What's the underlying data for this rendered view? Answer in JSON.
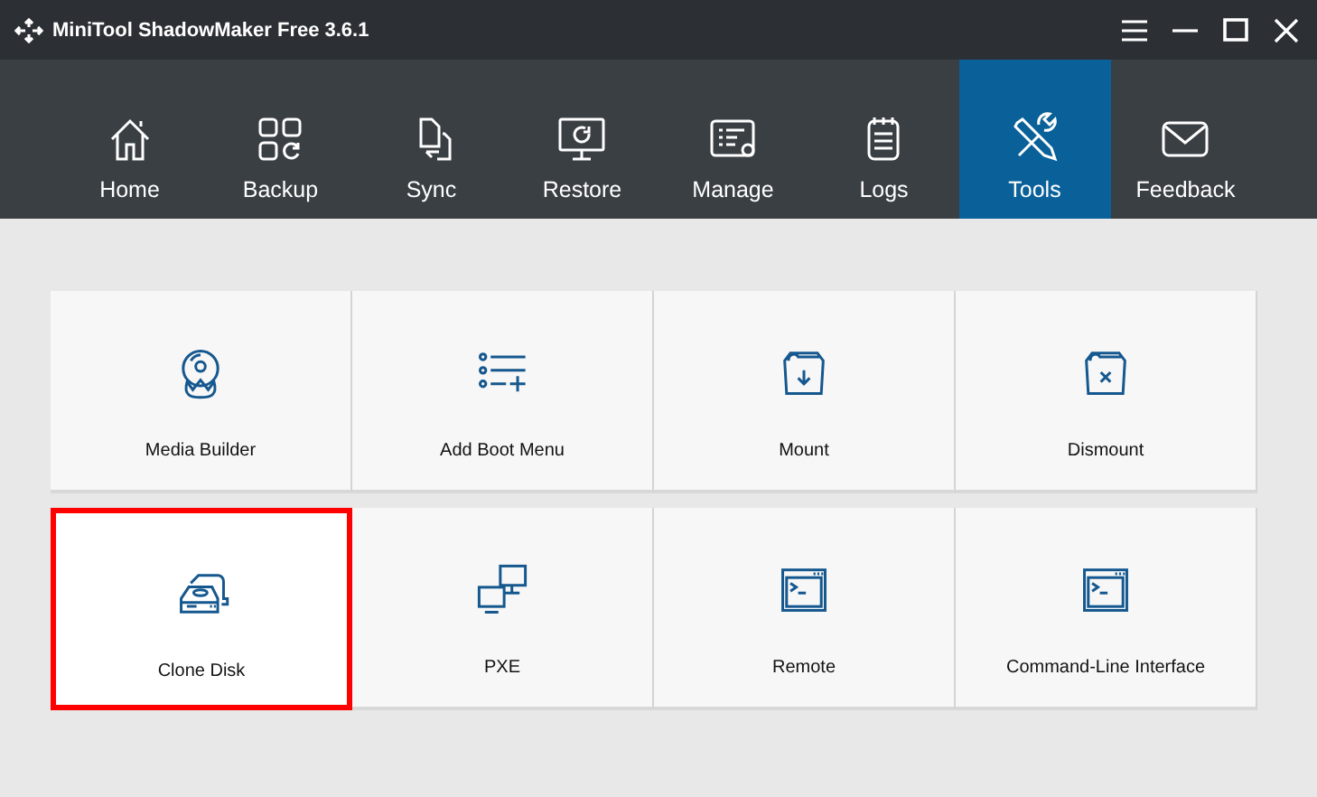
{
  "window": {
    "title": "MiniTool ShadowMaker Free 3.6.1"
  },
  "nav": [
    {
      "label": "Home",
      "selected": false
    },
    {
      "label": "Backup",
      "selected": false
    },
    {
      "label": "Sync",
      "selected": false
    },
    {
      "label": "Restore",
      "selected": false
    },
    {
      "label": "Manage",
      "selected": false
    },
    {
      "label": "Logs",
      "selected": false
    },
    {
      "label": "Tools",
      "selected": true
    },
    {
      "label": "Feedback",
      "selected": false
    }
  ],
  "tools": [
    {
      "label": "Media Builder",
      "highlighted": false
    },
    {
      "label": "Add Boot Menu",
      "highlighted": false
    },
    {
      "label": "Mount",
      "highlighted": false
    },
    {
      "label": "Dismount",
      "highlighted": false
    },
    {
      "label": "Clone Disk",
      "highlighted": true
    },
    {
      "label": "PXE",
      "highlighted": false
    },
    {
      "label": "Remote",
      "highlighted": false
    },
    {
      "label": "Command-Line Interface",
      "highlighted": false
    }
  ]
}
